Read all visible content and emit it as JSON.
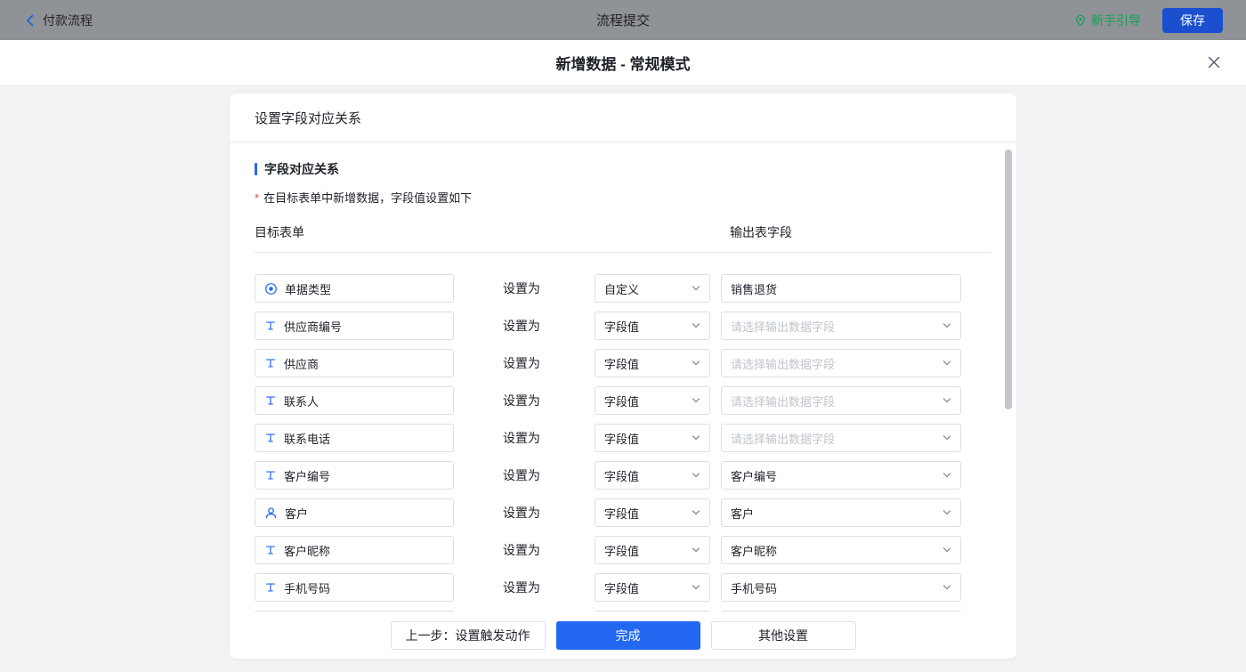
{
  "topbar": {
    "back_label": "付款流程",
    "title": "流程提交",
    "guide_label": "新手引导",
    "save_label": "保存"
  },
  "modal": {
    "title": "新增数据 - 常规模式"
  },
  "card": {
    "header": "设置字段对应关系",
    "section_title": "字段对应关系",
    "required_mark": "*",
    "note": "在目标表单中新增数据，字段值设置如下",
    "columns": {
      "left": "目标表单",
      "right": "输出表字段"
    },
    "set_to_label": "设置为",
    "rows": [
      {
        "field": "单据类型",
        "icon": "option-circle",
        "mode": "自定义",
        "output_type": "text",
        "output": "销售退货"
      },
      {
        "field": "供应商编号",
        "icon": "text",
        "mode": "字段值",
        "output_type": "select",
        "output": "",
        "placeholder": "请选择输出数据字段"
      },
      {
        "field": "供应商",
        "icon": "text",
        "mode": "字段值",
        "output_type": "select",
        "output": "",
        "placeholder": "请选择输出数据字段"
      },
      {
        "field": "联系人",
        "icon": "text",
        "mode": "字段值",
        "output_type": "select",
        "output": "",
        "placeholder": "请选择输出数据字段"
      },
      {
        "field": "联系电话",
        "icon": "text",
        "mode": "字段值",
        "output_type": "select",
        "output": "",
        "placeholder": "请选择输出数据字段"
      },
      {
        "field": "客户编号",
        "icon": "text",
        "mode": "字段值",
        "output_type": "select",
        "output": "客户编号"
      },
      {
        "field": "客户",
        "icon": "user",
        "mode": "字段值",
        "output_type": "select",
        "output": "客户"
      },
      {
        "field": "客户昵称",
        "icon": "text",
        "mode": "字段值",
        "output_type": "select",
        "output": "客户昵称"
      },
      {
        "field": "手机号码",
        "icon": "text",
        "mode": "字段值",
        "output_type": "select",
        "output": "手机号码"
      }
    ]
  },
  "footer": {
    "prev_label": "上一步：设置触发动作",
    "done_label": "完成",
    "other_label": "其他设置"
  },
  "colors": {
    "accent_blue": "#2468f2",
    "guide_green": "#18a058",
    "required_red": "#f53f3f",
    "topbar_gray": "#8f9296"
  }
}
